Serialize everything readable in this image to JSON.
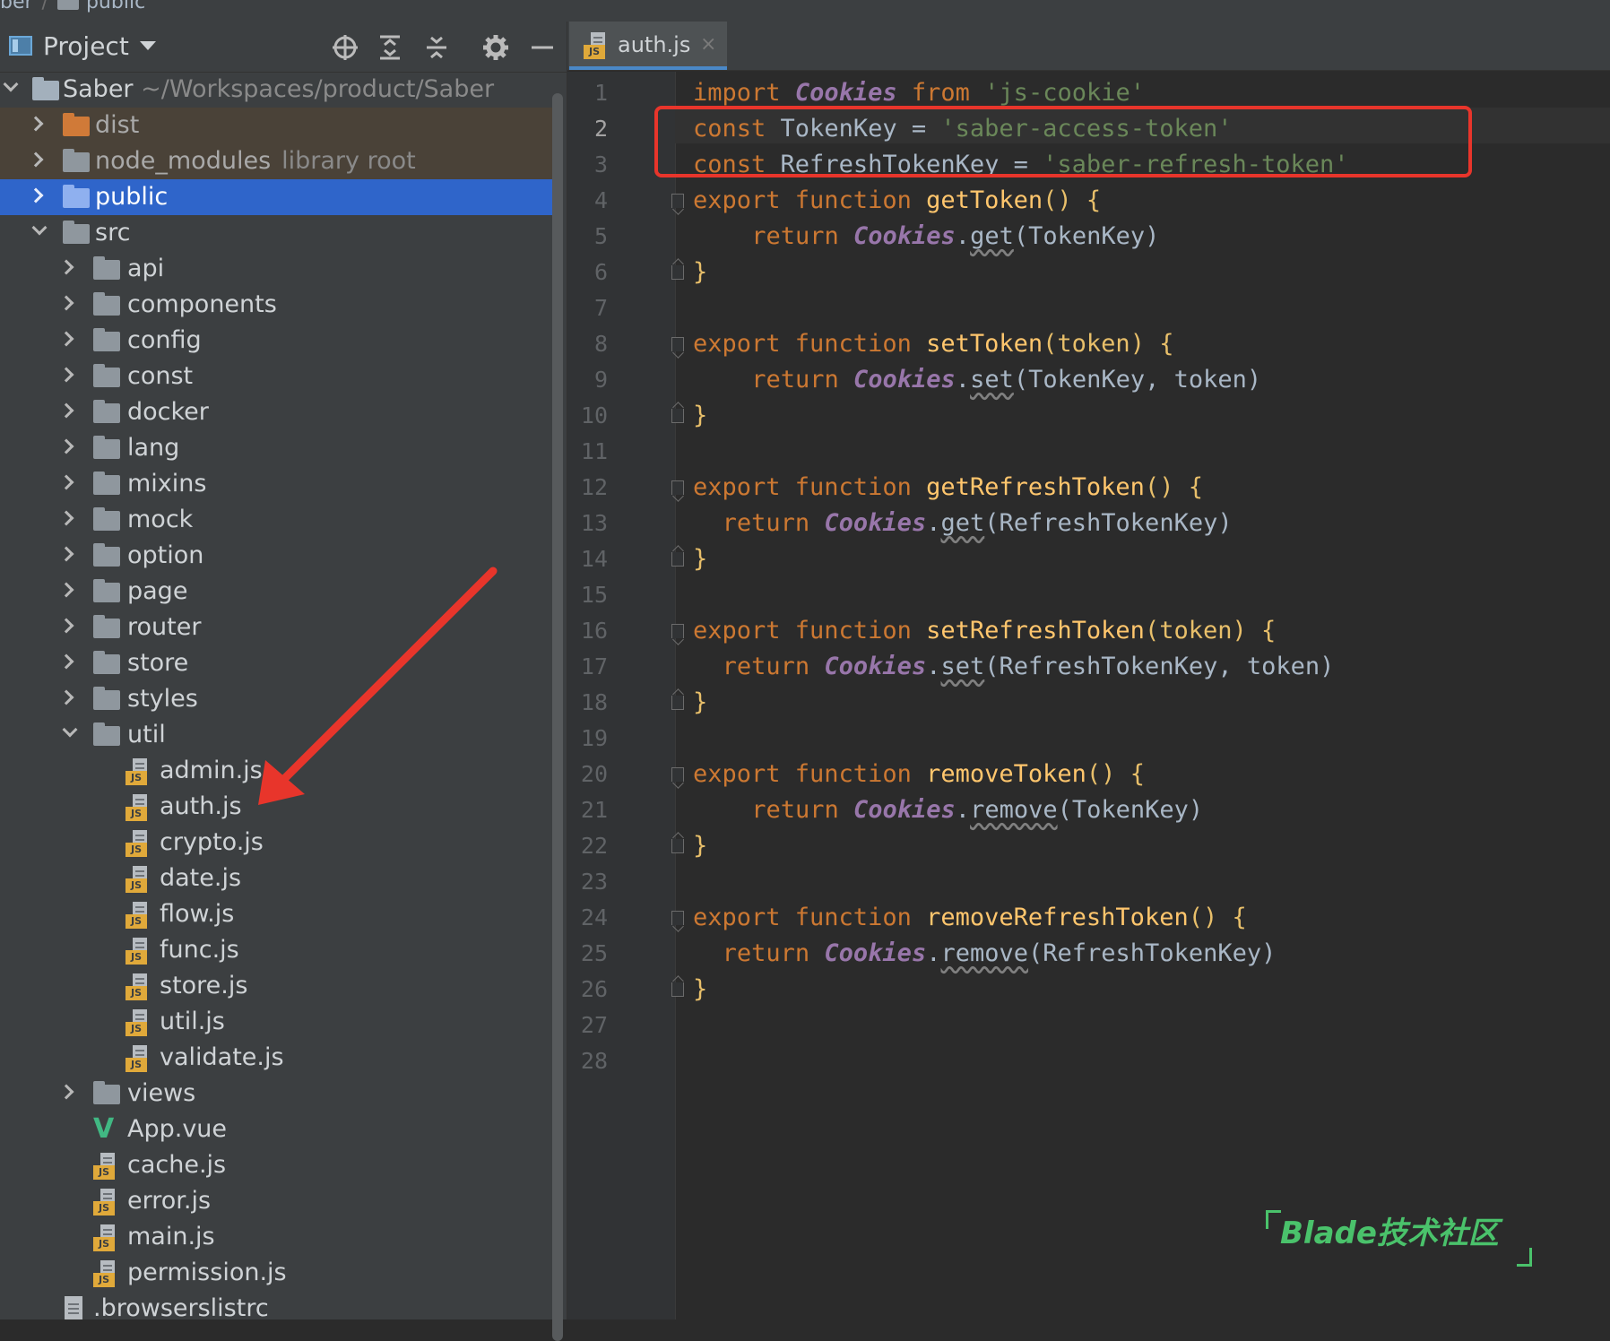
{
  "breadcrumb": {
    "items": [
      "ber",
      "public"
    ]
  },
  "project_panel": {
    "title": "Project",
    "toolbar": [
      "locate-icon",
      "expand-all-icon",
      "collapse-all-icon",
      "gear-icon",
      "hide-icon"
    ]
  },
  "tree": {
    "root_name": "Saber",
    "root_path": "~/Workspaces/product/Saber",
    "items": [
      {
        "label": "dist",
        "hint": ""
      },
      {
        "label": "node_modules",
        "hint": "library root"
      },
      {
        "label": "public",
        "hint": ""
      },
      {
        "label": "src",
        "hint": ""
      },
      {
        "label": "api"
      },
      {
        "label": "components"
      },
      {
        "label": "config"
      },
      {
        "label": "const"
      },
      {
        "label": "docker"
      },
      {
        "label": "lang"
      },
      {
        "label": "mixins"
      },
      {
        "label": "mock"
      },
      {
        "label": "option"
      },
      {
        "label": "page"
      },
      {
        "label": "router"
      },
      {
        "label": "store"
      },
      {
        "label": "styles"
      },
      {
        "label": "util"
      },
      {
        "label": "admin.js"
      },
      {
        "label": "auth.js"
      },
      {
        "label": "crypto.js"
      },
      {
        "label": "date.js"
      },
      {
        "label": "flow.js"
      },
      {
        "label": "func.js"
      },
      {
        "label": "store.js"
      },
      {
        "label": "util.js"
      },
      {
        "label": "validate.js"
      },
      {
        "label": "views"
      },
      {
        "label": "App.vue"
      },
      {
        "label": "cache.js"
      },
      {
        "label": "error.js"
      },
      {
        "label": "main.js"
      },
      {
        "label": "permission.js"
      },
      {
        "label": ".browserslistrc"
      }
    ],
    "js_badge": "JS"
  },
  "editor": {
    "tab_label": "auth.js",
    "tab_close": "×",
    "current_line": "2",
    "line_numbers": [
      "1",
      "2",
      "3",
      "4",
      "5",
      "6",
      "7",
      "8",
      "9",
      "10",
      "11",
      "12",
      "13",
      "14",
      "15",
      "16",
      "17",
      "18",
      "19",
      "20",
      "21",
      "22",
      "23",
      "24",
      "25",
      "26",
      "27",
      "28"
    ],
    "code": {
      "l1": [
        "import",
        "Cookies",
        "from",
        "'js-cookie'"
      ],
      "l2": [
        "const",
        "TokenKey =",
        "'saber-access-token'"
      ],
      "l3": [
        "const",
        "RefreshTokenKey =",
        "'saber-refresh-token'"
      ],
      "l4": [
        "export function",
        "getToken",
        "() {"
      ],
      "l5": [
        "return",
        "Cookies",
        "get",
        "(TokenKey)"
      ],
      "l8": [
        "export function",
        "setToken",
        "(token) {"
      ],
      "l9": [
        "return",
        "Cookies",
        "set",
        "(TokenKey, token)"
      ],
      "l12": [
        "export function",
        "getRefreshToken",
        "() {"
      ],
      "l13": [
        "return",
        "Cookies",
        "get",
        "(RefreshTokenKey)"
      ],
      "l16": [
        "export function",
        "setRefreshToken",
        "(token) {"
      ],
      "l17": [
        "return",
        "Cookies",
        "set",
        "(RefreshTokenKey, token)"
      ],
      "l20": [
        "export function",
        "removeToken",
        "() {"
      ],
      "l21": [
        "return",
        "Cookies",
        "remove",
        "(TokenKey)"
      ],
      "l24": [
        "export function",
        "removeRefreshToken",
        "() {"
      ],
      "l25": [
        "return",
        "Cookies",
        "remove",
        "(RefreshTokenKey)"
      ],
      "closing_brace": "}",
      "dot": "."
    }
  },
  "annotations": {
    "box_color": "#e8352b",
    "arrow_color": "#e8352b"
  },
  "watermark": {
    "text": "Blade技术社区",
    "color": "#4ac26b"
  }
}
